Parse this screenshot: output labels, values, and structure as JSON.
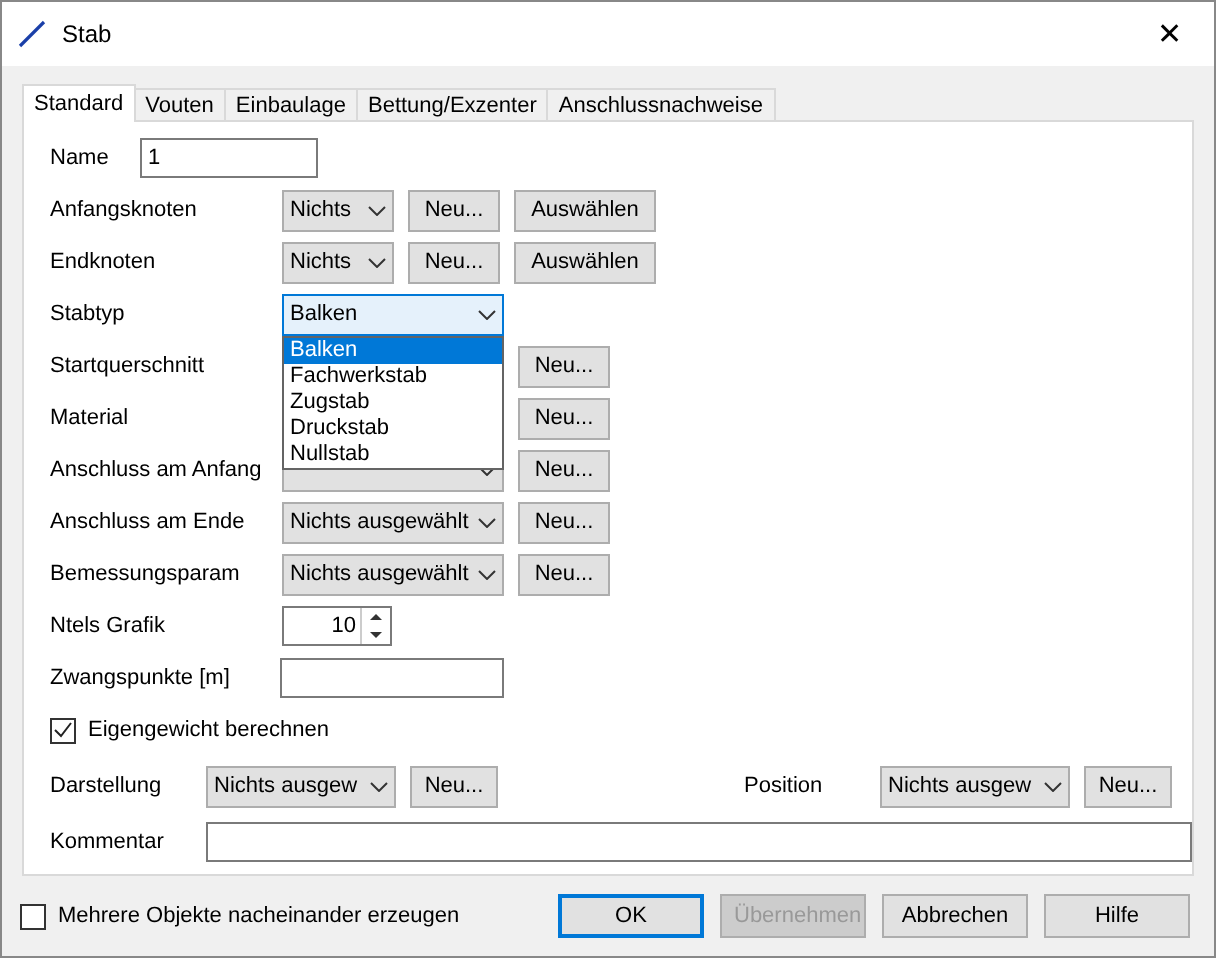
{
  "window": {
    "title": "Stab",
    "close": "✕"
  },
  "tabs": [
    {
      "label": "Standard",
      "selected": true
    },
    {
      "label": "Vouten",
      "selected": false
    },
    {
      "label": "Einbaulage",
      "selected": false
    },
    {
      "label": "Bettung/Exzenter",
      "selected": false
    },
    {
      "label": "Anschlussnachweise",
      "selected": false
    }
  ],
  "fields": [
    {
      "kind": "text",
      "label": "Name",
      "value": "1"
    },
    {
      "kind": "combo",
      "label": "Anfangsknoten",
      "value": "Nichts",
      "buttons": [
        "Neu...",
        "Auswählen"
      ]
    },
    {
      "kind": "combo",
      "label": "Endknoten",
      "value": "Nichts",
      "buttons": [
        "Neu...",
        "Auswählen"
      ]
    },
    {
      "kind": "combo",
      "label": "Stabtyp",
      "value": "Balken",
      "expanded": true,
      "options": [
        {
          "label": "Balken",
          "selected": true
        },
        {
          "label": "Fachwerkstab",
          "selected": false
        },
        {
          "label": "Zugstab",
          "selected": false
        },
        {
          "label": "Druckstab",
          "selected": false
        },
        {
          "label": "Nullstab",
          "selected": false
        }
      ]
    },
    {
      "kind": "covered",
      "label": "Startquerschnitt",
      "buttons": [
        "Neu..."
      ]
    },
    {
      "kind": "covered",
      "label": "Material",
      "buttons": [
        "Neu..."
      ]
    },
    {
      "kind": "combo",
      "label": "Anschluss am Anfang",
      "buttons": [
        "Neu..."
      ]
    },
    {
      "kind": "combo",
      "label": "Anschluss am Ende",
      "value": "Nichts ausgewählt",
      "buttons": [
        "Neu..."
      ]
    },
    {
      "kind": "combo",
      "label": "Bemessungsparam",
      "value": "Nichts ausgewählt",
      "buttons": [
        "Neu..."
      ]
    },
    {
      "kind": "spin",
      "label": "Ntels Grafik",
      "value": "10"
    },
    {
      "kind": "text",
      "label": "Zwangspunkte [m]"
    },
    {
      "kind": "checkbox",
      "label": "Eigengewicht berechnen",
      "checked": true
    }
  ],
  "display": {
    "label": "Darstellung",
    "value": "Nichts ausgew",
    "button": "Neu..."
  },
  "position": {
    "label": "Position",
    "value": "Nichts ausgew",
    "button": "Neu..."
  },
  "comment": {
    "label": "Kommentar"
  },
  "footer": {
    "checkbox": {
      "label": "Mehrere Objekte nacheinander erzeugen",
      "checked": false
    },
    "buttons": [
      {
        "label": "OK",
        "default": true,
        "disabled": false
      },
      {
        "label": "Übernehmen",
        "default": false,
        "disabled": true
      },
      {
        "label": "Abbrechen",
        "default": false,
        "disabled": false
      },
      {
        "label": "Hilfe",
        "default": false,
        "disabled": false
      }
    ]
  }
}
